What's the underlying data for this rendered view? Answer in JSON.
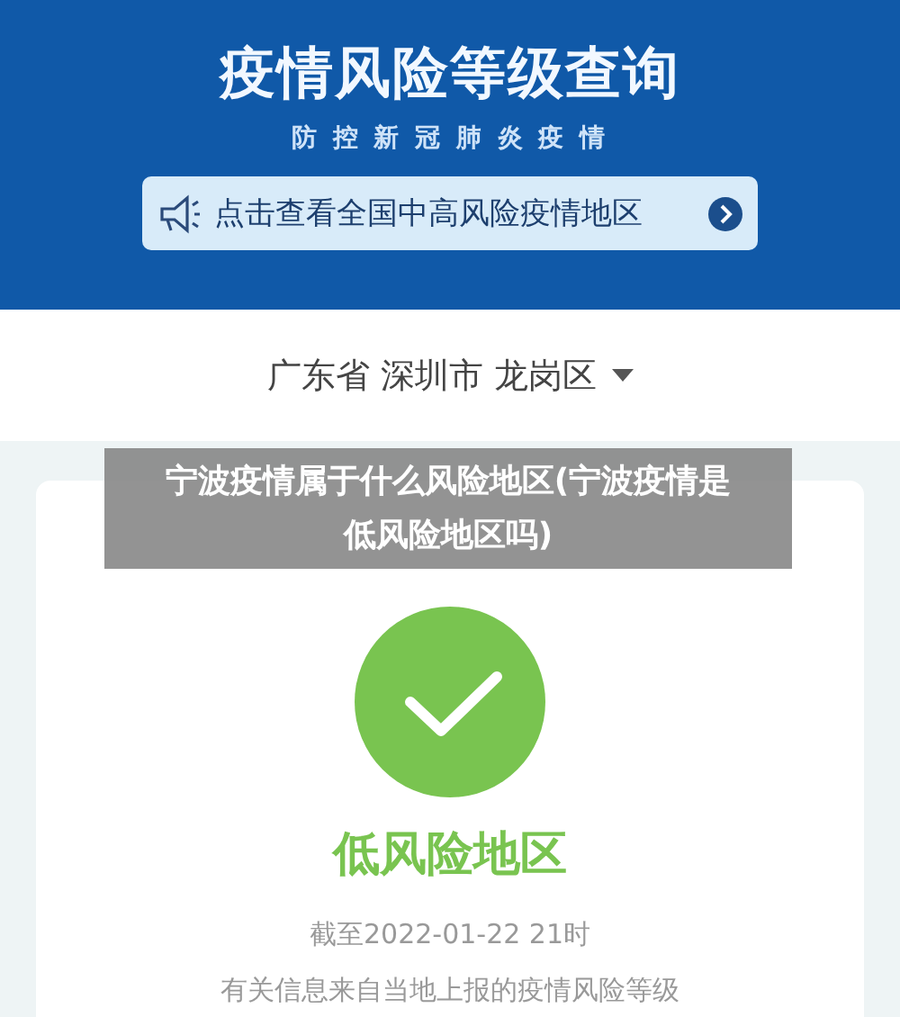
{
  "header": {
    "title": "疫情风险等级查询",
    "subtitle": "防 控 新 冠 肺 炎 疫 情",
    "notice_link": "点击查看全国中高风险疫情地区"
  },
  "location": {
    "label": "广东省 深圳市 龙岗区"
  },
  "result": {
    "kind": "low",
    "level_text": "低风险地区",
    "updated": "截至2022-01-22 21时",
    "note": "有关信息来自当地上报的疫情风险等级"
  },
  "caption": "宁波疫情属于什么风险地区(宁波疫情是低风险地区吗)"
}
